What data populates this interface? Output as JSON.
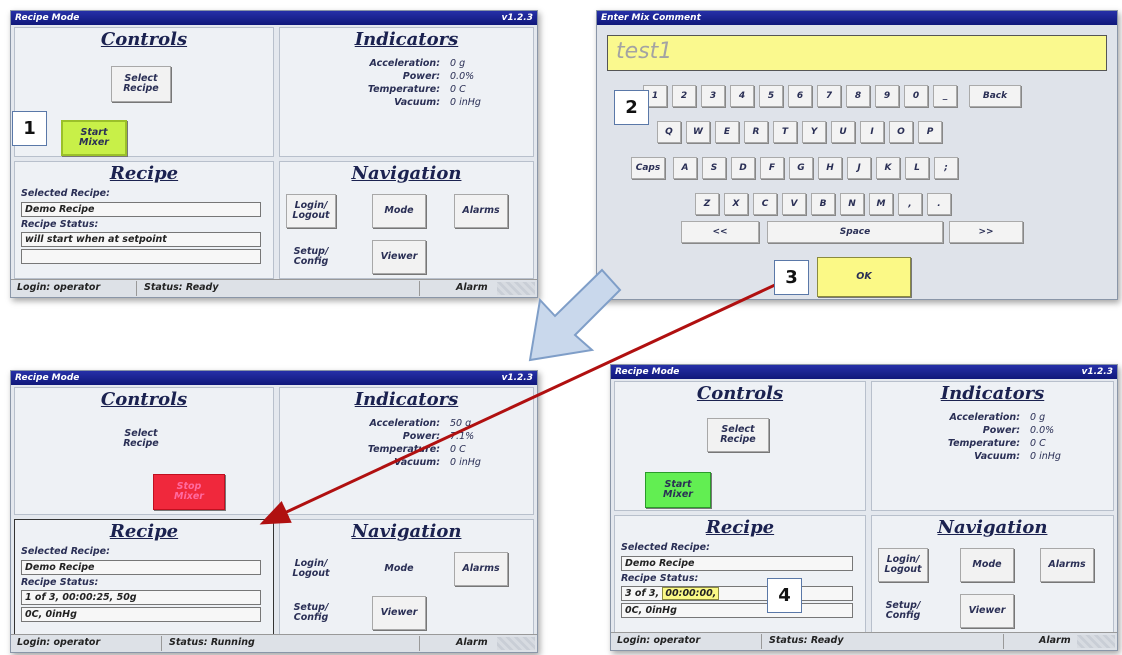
{
  "colors": {
    "titlebar": "#1a2290",
    "start_green": "#8fe44a",
    "stop_red": "#f0283c",
    "highlight_yellow": "#fbf986",
    "arrow_red": "#b01010",
    "callout_border": "#5a78a8"
  },
  "panels": {
    "top_left": {
      "title": "Recipe Mode",
      "version": "v1.2.3",
      "controls": {
        "title": "Controls",
        "select_recipe": "Select\nRecipe",
        "mixer_button": "Start\nMixer"
      },
      "indicators": {
        "title": "Indicators",
        "rows": [
          {
            "label": "Acceleration:",
            "value": "0 g"
          },
          {
            "label": "Power:",
            "value": "0.0%"
          },
          {
            "label": "Temperature:",
            "value": "0 C"
          },
          {
            "label": "Vacuum:",
            "value": "0 inHg"
          }
        ]
      },
      "recipe": {
        "title": "Recipe",
        "selected_label": "Selected Recipe:",
        "selected_value": "Demo Recipe",
        "status_label": "Recipe Status:",
        "status_line1": "will start when at setpoint",
        "status_line2": ""
      },
      "navigation": {
        "title": "Navigation",
        "login": "Login/\nLogout",
        "mode": "Mode",
        "alarms": "Alarms",
        "setup": "Setup/\nConfig",
        "viewer": "Viewer"
      },
      "statusbar": {
        "login": "Login: operator",
        "status": "Status: Ready",
        "alarm": "Alarm"
      }
    },
    "keyboard": {
      "title": "Enter Mix Comment",
      "input_value": "test1",
      "row1": [
        "1",
        "2",
        "3",
        "4",
        "5",
        "6",
        "7",
        "8",
        "9",
        "0",
        "_"
      ],
      "back": "Back",
      "row2": [
        "Q",
        "W",
        "E",
        "R",
        "T",
        "Y",
        "U",
        "I",
        "O",
        "P"
      ],
      "caps": "Caps",
      "row3": [
        "A",
        "S",
        "D",
        "F",
        "G",
        "H",
        "J",
        "K",
        "L",
        ";"
      ],
      "row4": [
        "Z",
        "X",
        "C",
        "V",
        "B",
        "N",
        "M",
        ",",
        "."
      ],
      "left": "<<",
      "space": "Space",
      "right": ">>",
      "ok": "OK"
    },
    "bottom_left": {
      "title": "Recipe Mode",
      "version": "v1.2.3",
      "controls": {
        "title": "Controls",
        "select_recipe": "Select\nRecipe",
        "mixer_button": "Stop\nMixer"
      },
      "indicators": {
        "title": "Indicators",
        "rows": [
          {
            "label": "Acceleration:",
            "value": "50 g"
          },
          {
            "label": "Power:",
            "value": "7.1%"
          },
          {
            "label": "Temperature:",
            "value": "0 C"
          },
          {
            "label": "Vacuum:",
            "value": "0 inHg"
          }
        ]
      },
      "recipe": {
        "title": "Recipe",
        "selected_label": "Selected Recipe:",
        "selected_value": "Demo Recipe",
        "status_label": "Recipe Status:",
        "status_line1": "1 of 3, 00:00:25, 50g",
        "status_line2": "0C, 0inHg"
      },
      "navigation": {
        "title": "Navigation",
        "login": "Login/\nLogout",
        "mode": "Mode",
        "alarms": "Alarms",
        "setup": "Setup/\nConfig",
        "viewer": "Viewer"
      },
      "statusbar": {
        "login": "Login: operator",
        "status": "Status: Running",
        "alarm": "Alarm"
      }
    },
    "bottom_right": {
      "title": "Recipe Mode",
      "version": "v1.2.3",
      "controls": {
        "title": "Controls",
        "select_recipe": "Select\nRecipe",
        "mixer_button": "Start\nMixer"
      },
      "indicators": {
        "title": "Indicators",
        "rows": [
          {
            "label": "Acceleration:",
            "value": "0 g"
          },
          {
            "label": "Power:",
            "value": "0.0%"
          },
          {
            "label": "Temperature:",
            "value": "0 C"
          },
          {
            "label": "Vacuum:",
            "value": "0 inHg"
          }
        ]
      },
      "recipe": {
        "title": "Recipe",
        "selected_label": "Selected Recipe:",
        "selected_value": "Demo Recipe",
        "status_label": "Recipe Status:",
        "status_line1_prefix": "3 of 3,",
        "status_line1_time": "00:00:00,",
        "status_line2": "0C, 0inHg"
      },
      "navigation": {
        "title": "Navigation",
        "login": "Login/\nLogout",
        "mode": "Mode",
        "alarms": "Alarms",
        "setup": "Setup/\nConfig",
        "viewer": "Viewer"
      },
      "statusbar": {
        "login": "Login: operator",
        "status": "Status: Ready",
        "alarm": "Alarm"
      }
    }
  },
  "callouts": {
    "c1": "1",
    "c2": "2",
    "c3": "3",
    "c4": "4"
  }
}
